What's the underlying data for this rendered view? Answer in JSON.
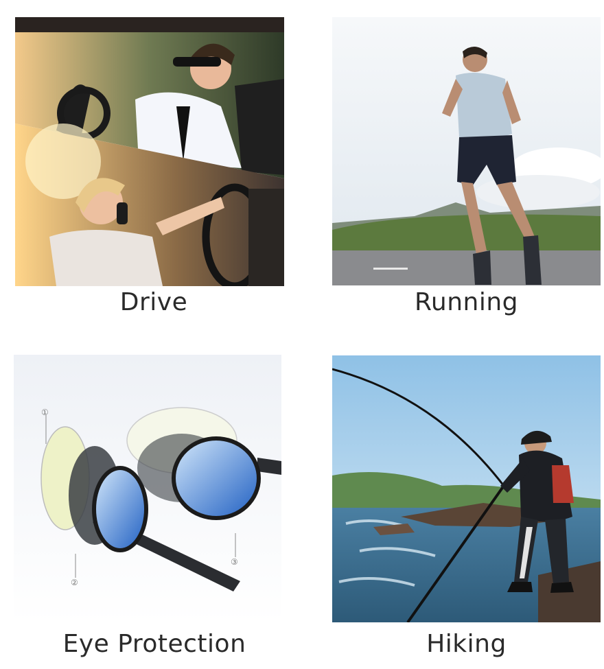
{
  "captions": {
    "drive": "Drive",
    "running": "Running",
    "eye_protection": "Eye Protection",
    "hiking": "Hiking"
  },
  "lens_markers": {
    "one": "①",
    "two": "②",
    "three": "③"
  },
  "colors": {
    "sky": "#cfe3f2",
    "sea": "#3e6f8f",
    "lens_blue": "#2f6fc4",
    "lens_dark": "#3b3f44",
    "lens_yellow": "#eef2c8",
    "text": "#2a2a2a"
  }
}
